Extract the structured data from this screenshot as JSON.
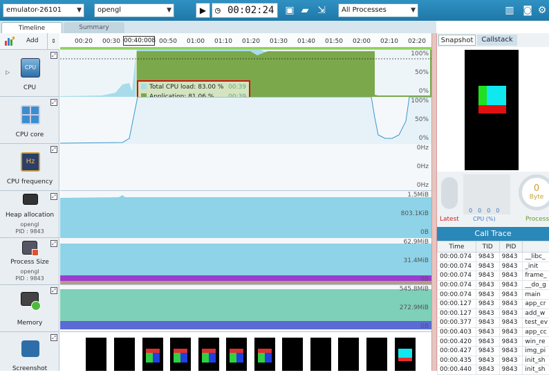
{
  "toolbar": {
    "device": "emulator-26101",
    "app": "opengl",
    "timer": "00:02:24",
    "process_filter": "All Processes",
    "icons": [
      "play-icon",
      "clock-icon",
      "save-icon",
      "open-folder-icon",
      "export-icon",
      "screenshot-device-icon",
      "camera-icon",
      "settings-icon"
    ]
  },
  "tabs": {
    "timeline": "Timeline",
    "summary": "Summary"
  },
  "left": {
    "add_label": "Add",
    "rows": [
      {
        "label": "CPU",
        "icon": "cpu-icon"
      },
      {
        "label": "CPU core",
        "icon": "cpu-core-icon"
      },
      {
        "label": "CPU frequency",
        "icon": "hz-icon",
        "icon_text": "Hz"
      },
      {
        "label": "Heap allocation",
        "icon": "memory-chip-icon",
        "sub1": "opengl",
        "sub2": "PID : 9843"
      },
      {
        "label": "Process Size",
        "icon": "process-size-icon",
        "sub1": "opengl",
        "sub2": "PID : 9843"
      },
      {
        "label": "Memory",
        "icon": "memory-icon"
      },
      {
        "label": "Screenshot",
        "icon": "screenshot-icon"
      }
    ]
  },
  "ruler": {
    "ticks": [
      "00:20",
      "00:30",
      "00:50",
      "01:00",
      "01:10",
      "01:20",
      "01:30",
      "01:40",
      "01:50",
      "02:00",
      "02:10",
      "02:20"
    ],
    "cursor": "00:40:008"
  },
  "axes": {
    "cpu": [
      "100%",
      "50%",
      "0%"
    ],
    "cpu_core": [
      "100%",
      "50%",
      "0%"
    ],
    "cpu_freq": [
      "0Hz",
      "0Hz",
      "0Hz"
    ],
    "heap": [
      "1.5MiB",
      "803.1KiB",
      "0B"
    ],
    "process_size": [
      "62.9MiB",
      "31.4MiB",
      "0B"
    ],
    "memory": [
      "545.8MiB",
      "272.9MiB",
      "0B"
    ]
  },
  "tooltip": {
    "total_label": "Total CPU load:",
    "total_value": "83.00 %",
    "total_time": "00:39",
    "app_label": "Application:",
    "app_value": "81.06 %",
    "app_time": "00:39"
  },
  "colors": {
    "toolbar": "#2a88b8",
    "cpu_total": "#a8dcea",
    "cpu_app": "#7ba84a",
    "heap": "#8fd3e8",
    "proc_purple": "#9b3bd0",
    "proc_tan": "#b49c84",
    "mem_teal": "#7ed0b8",
    "mem_blue": "#5b6ad4"
  },
  "right": {
    "tab_snapshot": "Snapshot",
    "tab_callstack": "Callstack",
    "cpu_label": "CPU (%)",
    "cpu_vals": [
      "0",
      "0",
      "0",
      "0"
    ],
    "gauge_value": "0",
    "gauge_unit": "Byte",
    "latest": "Latest",
    "process": "Process",
    "call_trace_title": "Call Trace",
    "columns": [
      "Time",
      "TID",
      "PID",
      ""
    ],
    "rows": [
      [
        "00:00.074",
        "9843",
        "9843",
        "__libc_"
      ],
      [
        "00:00.074",
        "9843",
        "9843",
        "_init"
      ],
      [
        "00:00.074",
        "9843",
        "9843",
        "frame_"
      ],
      [
        "00:00.074",
        "9843",
        "9843",
        "__do_g"
      ],
      [
        "00:00.074",
        "9843",
        "9843",
        "main"
      ],
      [
        "00:00.127",
        "9843",
        "9843",
        "app_cr"
      ],
      [
        "00:00.127",
        "9843",
        "9843",
        "add_w"
      ],
      [
        "00:00.377",
        "9843",
        "9843",
        "test_ev"
      ],
      [
        "00:00.403",
        "9843",
        "9843",
        "app_cc"
      ],
      [
        "00:00.420",
        "9843",
        "9843",
        "win_re"
      ],
      [
        "00:00.427",
        "9843",
        "9843",
        "img_pi"
      ],
      [
        "00:00.435",
        "9843",
        "9843",
        "init_sh"
      ],
      [
        "00:00.440",
        "9843",
        "9843",
        "init_sh"
      ]
    ]
  }
}
